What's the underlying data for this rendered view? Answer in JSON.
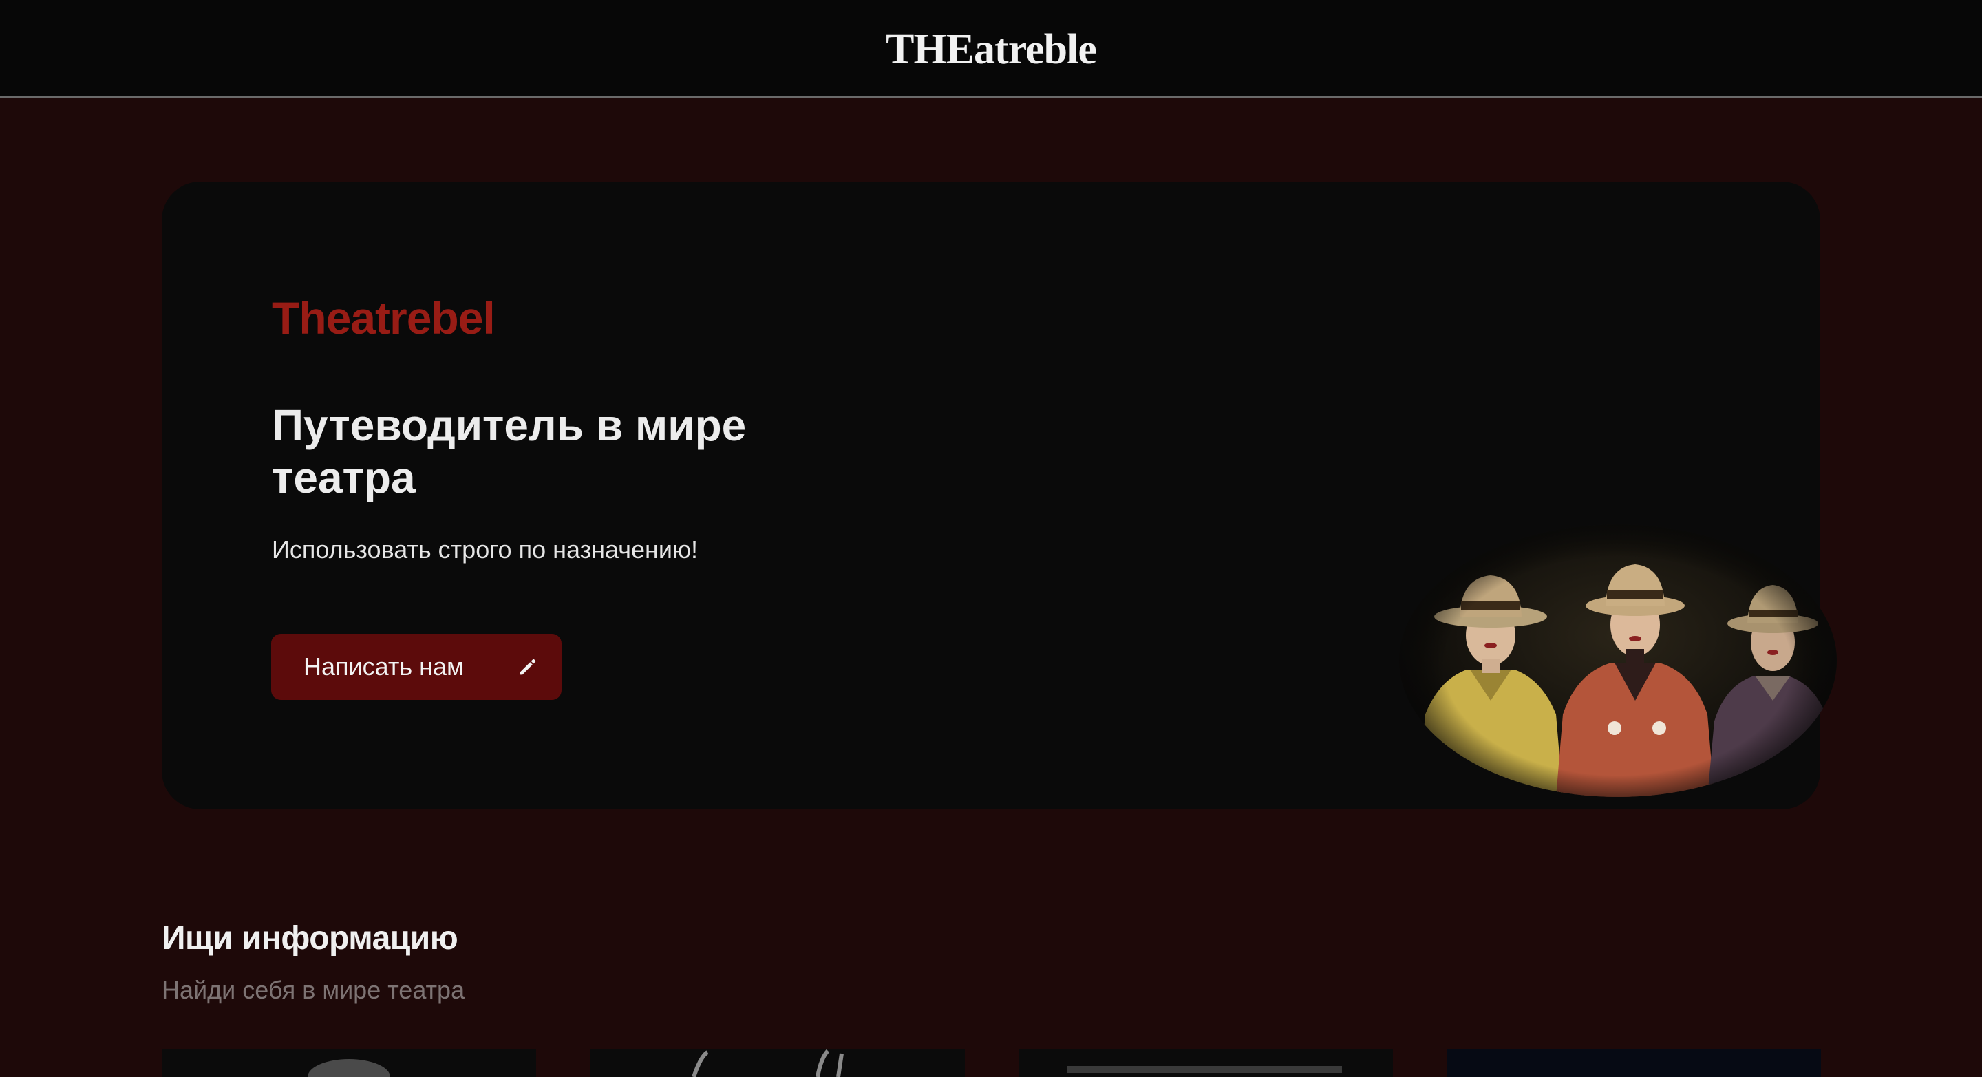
{
  "header": {
    "logo_text": "THEatreble"
  },
  "hero": {
    "brand": "Theatrebel",
    "headline": "Путеводитель в мире театра",
    "tagline": "Использовать строго по назначению!",
    "cta_label": "Написать нам",
    "cta_icon": "pencil-icon",
    "image": "theatre-actors-in-hats-photo"
  },
  "section": {
    "title": "Ищи информацию",
    "subtitle": "Найди себя в мире театра"
  },
  "colors": {
    "page_background": "#1e0909",
    "topbar_background": "#070707",
    "card_background": "#0a0a0a",
    "brand_red": "#981c15",
    "button_background": "#5c0b0b"
  }
}
